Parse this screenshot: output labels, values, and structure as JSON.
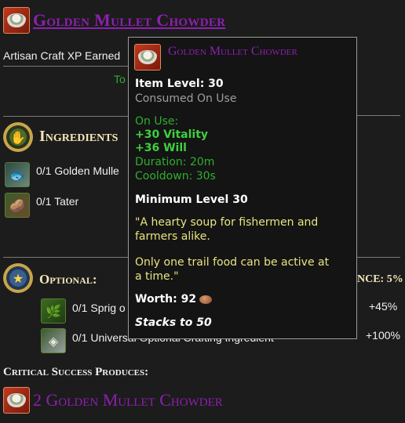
{
  "header": {
    "title": "Golden Mullet Chowder",
    "xp_label": "Artisan Craft XP Earned"
  },
  "partial_text": {
    "green_fragment": "To",
    "chance_fragment": "NCE: 5%",
    "plus45": "+45%",
    "plus100": "+100%"
  },
  "ingredients": {
    "heading": "Ingredients",
    "items": [
      {
        "label": "0/1 Golden Mulle",
        "icon": "fish-icon"
      },
      {
        "label": "0/1 Tater",
        "icon": "potato-icon"
      }
    ]
  },
  "optional": {
    "heading": "Optional:",
    "items": [
      {
        "label": "0/1 Sprig o",
        "icon": "herb-icon"
      },
      {
        "label": "0/1 Universal Optional Crafting Ingredient",
        "icon": "ingredient-icon"
      }
    ]
  },
  "critical": {
    "heading": "Critical Success Produces:",
    "result": "2 Golden Mullet Chowder"
  },
  "tooltip": {
    "title": "Golden Mullet Chowder",
    "item_level": "Item Level: 30",
    "consumed": "Consumed On Use",
    "on_use": "On Use:",
    "vitality": "+30 Vitality",
    "will": "+36 Will",
    "duration": "Duration: 20m",
    "cooldown": "Cooldown: 30s",
    "min_level": "Minimum Level 30",
    "flavor1": "\"A hearty soup for fishermen and",
    "flavor2": "farmers alike.",
    "flavor3": "Only one trail food can be active at",
    "flavor4": "a time.\"",
    "worth": "Worth: 92",
    "stacks": "Stacks to 50"
  },
  "colors": {
    "title_purple": "#8e1fb0",
    "green": "#3fcf3f",
    "flavor_yellow": "#e9e57f"
  }
}
